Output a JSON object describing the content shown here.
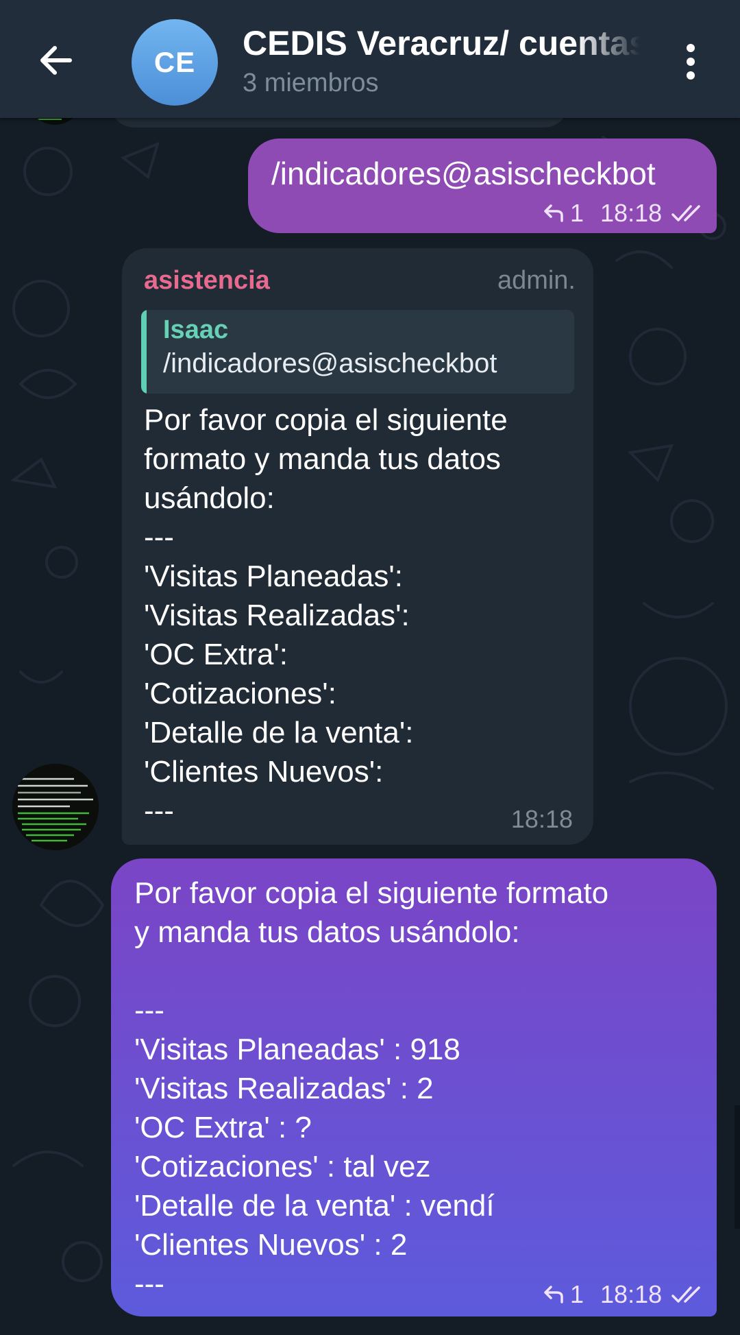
{
  "header": {
    "back_label": "back",
    "avatar_initials": "CE",
    "title": "CEDIS Veracruz/ cuentas",
    "subtitle": "3 miembros"
  },
  "messages": {
    "out1": {
      "text": "/indicadores@asischeckbot",
      "reply_count": "1",
      "time": "18:18"
    },
    "incoming": {
      "sender": "asistencia",
      "role": "admin.",
      "quote_name": "Isaac",
      "quote_text": "/indicadores@asischeckbot",
      "body": "Por favor copia el siguiente\nformato y manda tus datos\nusándolo:\n---\n'Visitas Planeadas':\n'Visitas Realizadas':\n'OC Extra':\n'Cotizaciones':\n'Detalle de la venta':\n'Clientes Nuevos':\n---",
      "time": "18:18"
    },
    "out2": {
      "body": "Por favor copia el siguiente formato\ny manda tus datos usándolo:\n\n---\n'Visitas Planeadas' : 918\n'Visitas Realizadas' : 2\n'OC Extra' : ?\n'Cotizaciones' : tal vez\n'Detalle de la venta' :  vendí\n'Clientes Nuevos' : 2\n---",
      "reply_count": "1",
      "time": "18:18"
    }
  },
  "colors": {
    "header_bg": "#212d3b",
    "chat_bg": "#141c26",
    "outgoing_bubble": "#8e4bb4",
    "incoming_bubble": "#212b36",
    "sender_name": "#e86a8f",
    "quote_accent": "#5fcfb5",
    "avatar_gradient": "#4d8fd8"
  },
  "icons": {
    "back": "arrow-left-icon",
    "menu": "more-vertical-icon",
    "reply": "reply-arrow-icon",
    "read": "double-check-icon"
  }
}
